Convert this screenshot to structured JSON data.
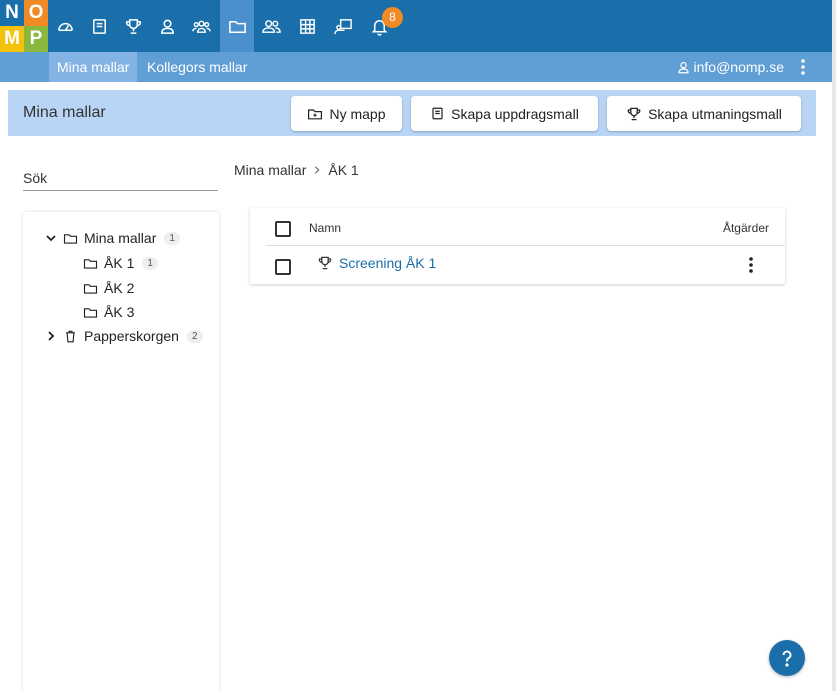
{
  "logo": {
    "letters": [
      "N",
      "O",
      "M",
      "P"
    ],
    "colors": [
      "#1a6faa",
      "#f08a24",
      "#f4c20d",
      "#8ab73d"
    ]
  },
  "topnav": {
    "icons": [
      "dashboard-icon",
      "book-icon",
      "trophy-icon",
      "user-icon",
      "group-icon",
      "folder-icon",
      "users-icon",
      "grid-icon",
      "presentation-icon",
      "bell-icon"
    ],
    "notification_count": "8"
  },
  "subnav": {
    "tabs": [
      {
        "label": "Mina mallar",
        "active": true
      },
      {
        "label": "Kollegors mallar",
        "active": false
      }
    ],
    "user_email": "info@nomp.se"
  },
  "header": {
    "title": "Mina mallar",
    "buttons": {
      "new_folder": "Ny mapp",
      "create_assignment": "Skapa uppdragsmall",
      "create_challenge": "Skapa utmaningsmall"
    }
  },
  "search": {
    "label": "Sök"
  },
  "tree": {
    "root": {
      "label": "Mina mallar",
      "count": "1"
    },
    "children": [
      {
        "label": "ÅK 1",
        "count": "1"
      },
      {
        "label": "ÅK 2"
      },
      {
        "label": "ÅK 3"
      }
    ],
    "trash": {
      "label": "Papperskorgen",
      "count": "2"
    }
  },
  "breadcrumb": {
    "items": [
      "Mina mallar",
      "ÅK 1"
    ]
  },
  "table": {
    "headers": {
      "name": "Namn",
      "actions": "Åtgärder"
    },
    "rows": [
      {
        "name": "Screening ÅK 1"
      }
    ]
  },
  "colors": {
    "primary": "#1a6faa",
    "subnav": "#5f9fd6",
    "header_bg": "#b9d5f5",
    "badge": "#f08a24"
  }
}
